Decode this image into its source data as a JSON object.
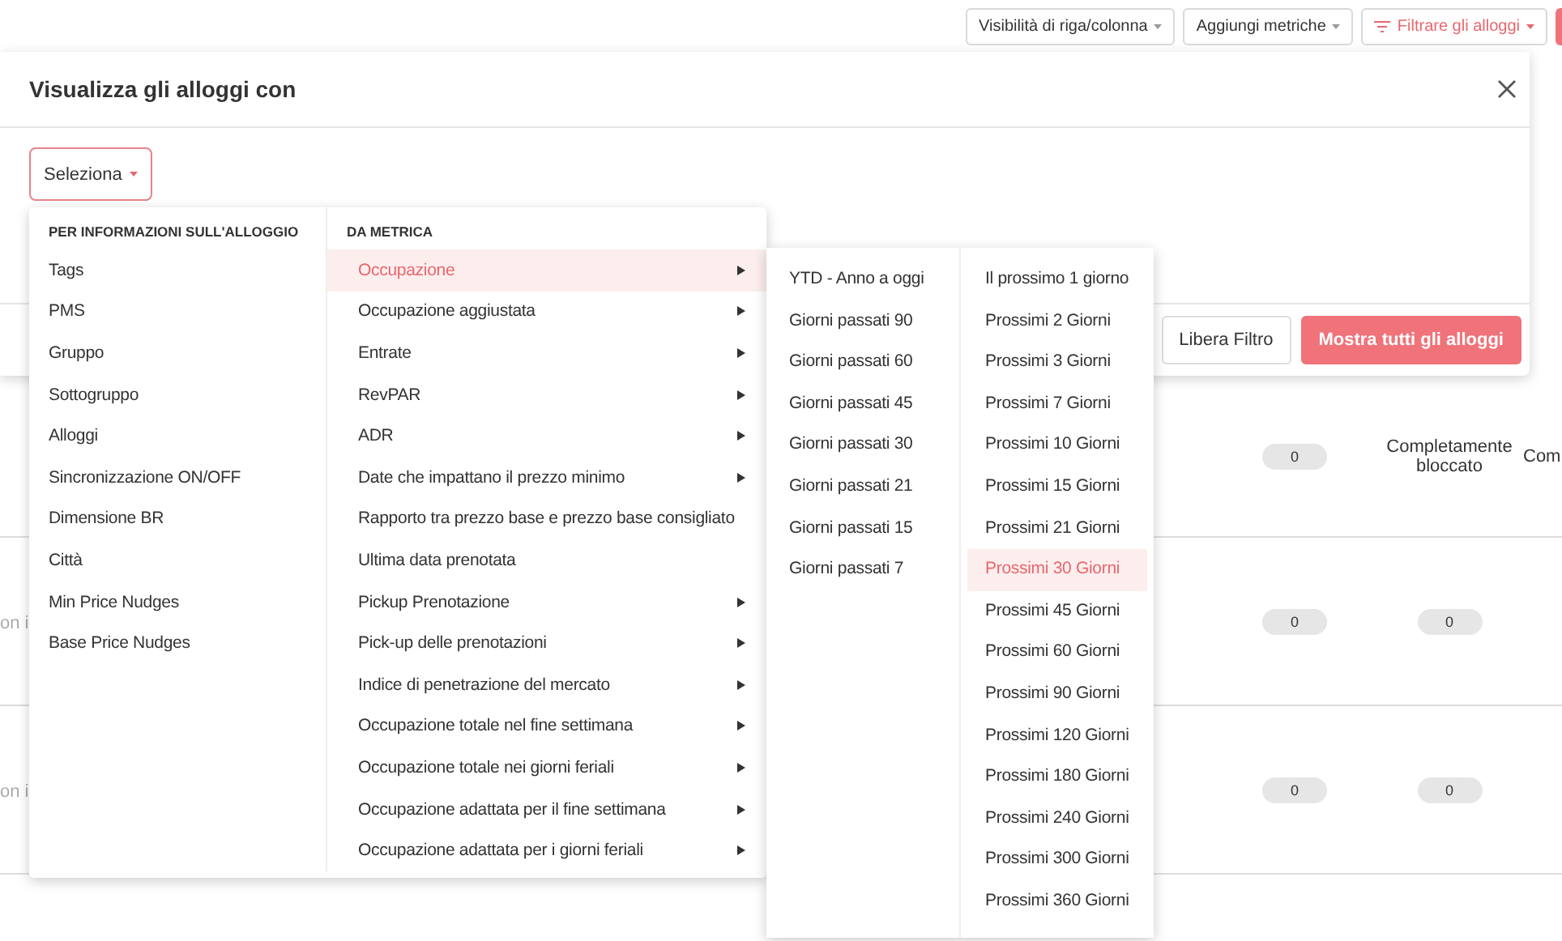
{
  "toolbar": {
    "buttons": [
      {
        "label": "Visibilità di riga/colonna",
        "kind": "plain"
      },
      {
        "label": "Aggiungi metriche",
        "kind": "plain"
      },
      {
        "label": "Filtrare gli alloggi",
        "kind": "filter"
      }
    ]
  },
  "modal": {
    "title": "Visualizza gli alloggi con",
    "select": {
      "label": "Seleziona"
    },
    "buttons": [
      {
        "label": "Libera Filtro",
        "kind": "secondary"
      },
      {
        "label": "Mostra tutti gli alloggi",
        "kind": "primary"
      }
    ]
  },
  "dropdown": {
    "sections": [
      {
        "heading": "PER INFORMAZIONI SULL'ALLOGGIO",
        "items": [
          {
            "label": "Tags",
            "selected": false,
            "has_submenu": false
          },
          {
            "label": "PMS",
            "selected": false,
            "has_submenu": false
          },
          {
            "label": "Gruppo",
            "selected": false,
            "has_submenu": false
          },
          {
            "label": "Sottogruppo",
            "selected": false,
            "has_submenu": false
          },
          {
            "label": "Alloggi",
            "selected": false,
            "has_submenu": false
          },
          {
            "label": "Sincronizzazione ON/OFF",
            "selected": false,
            "has_submenu": false
          },
          {
            "label": "Dimensione BR",
            "selected": false,
            "has_submenu": false
          },
          {
            "label": "Città",
            "selected": false,
            "has_submenu": false
          },
          {
            "label": "Min Price Nudges",
            "selected": false,
            "has_submenu": false
          },
          {
            "label": "Base Price Nudges",
            "selected": false,
            "has_submenu": false
          }
        ]
      },
      {
        "heading": "DA METRICA",
        "items": [
          {
            "label": "Occupazione",
            "selected": true,
            "has_submenu": true
          },
          {
            "label": "Occupazione aggiustata",
            "selected": false,
            "has_submenu": true
          },
          {
            "label": "Entrate",
            "selected": false,
            "has_submenu": true
          },
          {
            "label": "RevPAR",
            "selected": false,
            "has_submenu": true
          },
          {
            "label": "ADR",
            "selected": false,
            "has_submenu": true
          },
          {
            "label": "Date che impattano il prezzo minimo",
            "selected": false,
            "has_submenu": true
          },
          {
            "label": "Rapporto tra prezzo base e prezzo base consigliato",
            "selected": false,
            "has_submenu": false
          },
          {
            "label": "Ultima data prenotata",
            "selected": false,
            "has_submenu": false
          },
          {
            "label": "Pickup Prenotazione",
            "selected": false,
            "has_submenu": true
          },
          {
            "label": "Pick-up delle prenotazioni",
            "selected": false,
            "has_submenu": true
          },
          {
            "label": "Indice di penetrazione del mercato",
            "selected": false,
            "has_submenu": true
          },
          {
            "label": "Occupazione totale nel fine settimana",
            "selected": false,
            "has_submenu": true
          },
          {
            "label": "Occupazione totale nei giorni feriali",
            "selected": false,
            "has_submenu": true
          },
          {
            "label": "Occupazione adattata per il fine settimana",
            "selected": false,
            "has_submenu": true
          },
          {
            "label": "Occupazione adattata per i giorni feriali",
            "selected": false,
            "has_submenu": true
          }
        ]
      }
    ]
  },
  "submenu": {
    "columns": [
      {
        "items": [
          {
            "label": "YTD - Anno a oggi",
            "selected": false
          },
          {
            "label": "Giorni passati 90",
            "selected": false
          },
          {
            "label": "Giorni passati 60",
            "selected": false
          },
          {
            "label": "Giorni passati 45",
            "selected": false
          },
          {
            "label": "Giorni passati 30",
            "selected": false
          },
          {
            "label": "Giorni passati 21",
            "selected": false
          },
          {
            "label": "Giorni passati 15",
            "selected": false
          },
          {
            "label": "Giorni passati 7",
            "selected": false
          }
        ]
      },
      {
        "items": [
          {
            "label": "Il prossimo 1 giorno",
            "selected": false
          },
          {
            "label": "Prossimi 2 Giorni",
            "selected": false
          },
          {
            "label": "Prossimi 3 Giorni",
            "selected": false
          },
          {
            "label": "Prossimi 7 Giorni",
            "selected": false
          },
          {
            "label": "Prossimi 10 Giorni",
            "selected": false
          },
          {
            "label": "Prossimi 15 Giorni",
            "selected": false
          },
          {
            "label": "Prossimi 21 Giorni",
            "selected": false
          },
          {
            "label": "Prossimi 30 Giorni",
            "selected": true
          },
          {
            "label": "Prossimi 45 Giorni",
            "selected": false
          },
          {
            "label": "Prossimi 60 Giorni",
            "selected": false
          },
          {
            "label": "Prossimi 90 Giorni",
            "selected": false
          },
          {
            "label": "Prossimi 120 Giorni",
            "selected": false
          },
          {
            "label": "Prossimi 180 Giorni",
            "selected": false
          },
          {
            "label": "Prossimi 240 Giorni",
            "selected": false
          },
          {
            "label": "Prossimi 300 Giorni",
            "selected": false
          },
          {
            "label": "Prossimi 360 Giorni",
            "selected": false
          }
        ]
      }
    ]
  },
  "table": {
    "rows": [
      {
        "cells": [
          {
            "kind": "empty"
          },
          {
            "kind": "pill",
            "text": "0"
          },
          {
            "kind": "text",
            "text": "Completamente bloccato"
          },
          {
            "kind": "text",
            "text": "Com"
          }
        ]
      },
      {
        "cells": [
          {
            "kind": "faded",
            "text": "on i"
          },
          {
            "kind": "pill",
            "text": "0"
          },
          {
            "kind": "pill",
            "text": "0"
          }
        ]
      },
      {
        "cells": [
          {
            "kind": "faded",
            "text": "on i"
          },
          {
            "kind": "pill",
            "text": "0"
          },
          {
            "kind": "pill",
            "text": "0"
          }
        ]
      }
    ]
  }
}
